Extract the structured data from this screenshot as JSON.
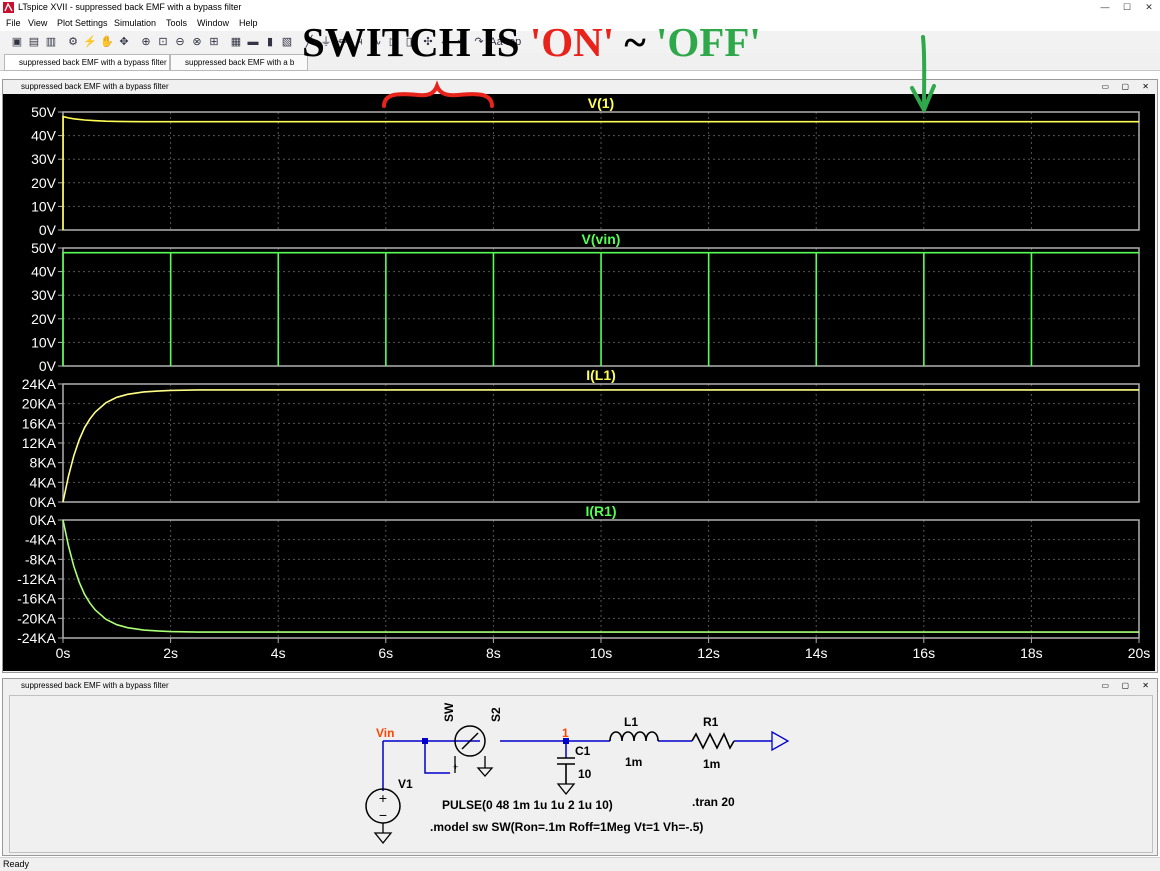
{
  "window": {
    "title": "LTspice XVII - suppressed back EMF with a bypass filter",
    "minimize": "—",
    "maximize": "☐",
    "close": "✕"
  },
  "menu": [
    "File",
    "View",
    "Plot Settings",
    "Simulation",
    "Tools",
    "Window",
    "Help"
  ],
  "toolbar_icons": [
    "new-schematic-icon",
    "open-icon",
    "save-icon",
    "control-panel-icon",
    "run-icon",
    "halt-icon",
    "pan-icon",
    "zoom-in-icon",
    "zoom-area-icon",
    "zoom-out-icon",
    "zoom-fit-icon",
    "autorange-icon",
    "tile-icon",
    "horizontal-split-icon",
    "vertical-split-icon",
    "cascade-icon",
    "wire-icon",
    "ground-icon",
    "resistor-icon",
    "capacitor-icon",
    "inductor-icon",
    "diode-icon",
    "component-icon",
    "move-icon",
    "drag-icon",
    "undo-icon",
    "redo-icon",
    "text-icon",
    "spice-directive-icon"
  ],
  "tabs": [
    {
      "label": "suppressed back EMF with a bypass filter",
      "active": true
    },
    {
      "label": "suppressed back EMF with a b",
      "active": false
    }
  ],
  "annotation": {
    "prefix": "SWITCH IS ",
    "on": "'ON'",
    "sep": " ~ ",
    "off": "'OFF'",
    "on_color": "#e8231c",
    "off_color": "#2ea84a",
    "text_color": "#000000"
  },
  "plot_window": {
    "title": "suppressed back EMF with a bypass filter"
  },
  "plot": {
    "bg": "#000000",
    "frame": "#b0b0b0",
    "grid": "#555555",
    "label_color": "#ffffff"
  },
  "chart_data": [
    {
      "type": "line",
      "title": "V(1)",
      "title_color": "#ffff55",
      "ylim": [
        0,
        50
      ],
      "yticks": [
        0,
        10,
        20,
        30,
        40,
        50
      ],
      "ytick_labels": [
        "0V",
        "10V",
        "20V",
        "30V",
        "40V",
        "50V"
      ],
      "series": [
        {
          "name": "V(1)",
          "color": "#ffff55",
          "x": [
            0,
            0.001,
            0.05,
            0.1,
            0.2,
            0.4,
            0.6,
            0.8,
            1.0,
            1.5,
            2,
            5,
            10,
            15,
            20
          ],
          "y": [
            0,
            48,
            47.8,
            47.5,
            47.1,
            46.6,
            46.3,
            46.1,
            46.0,
            45.9,
            45.9,
            45.9,
            45.9,
            45.9,
            45.9
          ]
        }
      ]
    },
    {
      "type": "line",
      "title": "V(vin)",
      "title_color": "#55ff55",
      "ylim": [
        0,
        50
      ],
      "yticks": [
        0,
        10,
        20,
        30,
        40,
        50
      ],
      "ytick_labels": [
        "0V",
        "10V",
        "20V",
        "30V",
        "40V",
        "50V"
      ],
      "series": [
        {
          "name": "V(vin)",
          "color": "#55ff55",
          "pulse": {
            "v1": 0,
            "v2": 48,
            "tdelay": 0.001,
            "ton": 2,
            "period": 2,
            "cycles": 10,
            "end": 20
          }
        }
      ]
    },
    {
      "type": "line",
      "title": "I(L1)",
      "title_color": "#ffff55",
      "ylim": [
        0,
        24
      ],
      "yticks": [
        0,
        4,
        8,
        12,
        16,
        20,
        24
      ],
      "ytick_labels": [
        "0KA",
        "4KA",
        "8KA",
        "12KA",
        "16KA",
        "20KA",
        "24KA"
      ],
      "series": [
        {
          "name": "I(L1)",
          "color": "#ffff88",
          "x": [
            0,
            0.1,
            0.2,
            0.3,
            0.4,
            0.5,
            0.6,
            0.8,
            1.0,
            1.2,
            1.5,
            1.8,
            2.0,
            2.5,
            3,
            5,
            10,
            15,
            20
          ],
          "y": [
            0,
            5.2,
            9.4,
            12.6,
            15.1,
            16.9,
            18.3,
            20.2,
            21.3,
            21.9,
            22.4,
            22.6,
            22.7,
            22.8,
            22.8,
            22.8,
            22.8,
            22.8,
            22.8
          ]
        }
      ]
    },
    {
      "type": "line",
      "title": "I(R1)",
      "title_color": "#55ff55",
      "ylim": [
        -24,
        0
      ],
      "yticks": [
        0,
        -4,
        -8,
        -12,
        -16,
        -20,
        -24
      ],
      "ytick_labels": [
        "0KA",
        "-4KA",
        "-8KA",
        "-12KA",
        "-16KA",
        "-20KA",
        "-24KA"
      ],
      "series": [
        {
          "name": "I(R1)",
          "color": "#aaff77",
          "x": [
            0,
            0.1,
            0.2,
            0.3,
            0.4,
            0.5,
            0.6,
            0.8,
            1.0,
            1.2,
            1.5,
            1.8,
            2.0,
            2.5,
            3,
            5,
            10,
            15,
            20
          ],
          "y": [
            0,
            -5.2,
            -9.4,
            -12.6,
            -15.1,
            -16.9,
            -18.3,
            -20.2,
            -21.3,
            -21.9,
            -22.4,
            -22.6,
            -22.7,
            -22.8,
            -22.8,
            -22.8,
            -22.8,
            -22.8,
            -22.8
          ]
        }
      ]
    }
  ],
  "x_axis": {
    "xlim": [
      0,
      20
    ],
    "ticks": [
      0,
      2,
      4,
      6,
      8,
      10,
      12,
      14,
      16,
      18,
      20
    ],
    "labels": [
      "0s",
      "2s",
      "4s",
      "6s",
      "8s",
      "10s",
      "12s",
      "14s",
      "16s",
      "18s",
      "20s"
    ]
  },
  "schematic_window": {
    "title": "suppressed back EMF with a bypass filter"
  },
  "schematic": {
    "vin_label": "Vin",
    "node1_label": "1",
    "v1_label": "V1",
    "sw_label": "SW",
    "s2_label": "S2",
    "c1_label": "C1",
    "c1_value": "10",
    "l1_label": "L1",
    "l1_value": "1m",
    "r1_label": "R1",
    "r1_value": "1m",
    "plus": "+",
    "pulse": "PULSE(0 48 1m 1u 1u 2 1u 10)",
    "tran": ".tran 20",
    "model": ".model sw SW(Ron=.1m Roff=1Meg Vt=1 Vh=-.5)",
    "node_color": "#ff4400",
    "wire_color": "#0000cc"
  },
  "status": "Ready"
}
